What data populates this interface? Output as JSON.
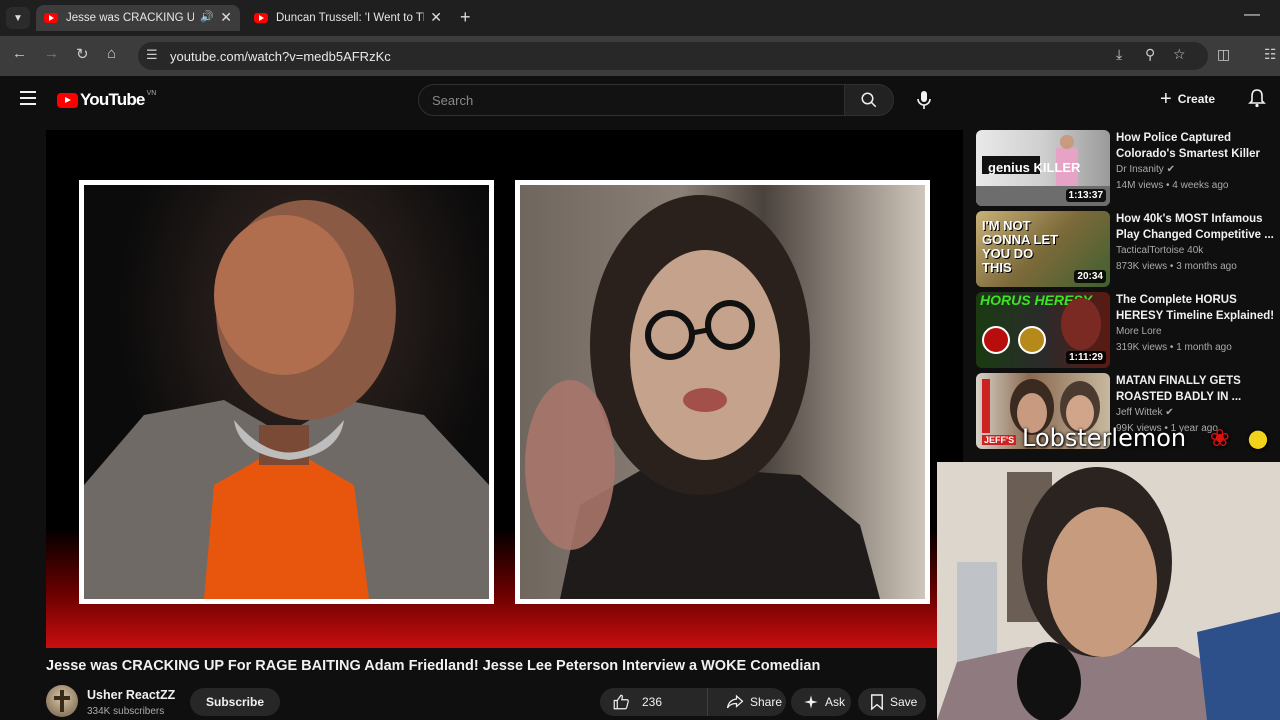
{
  "browser": {
    "tabs": [
      {
        "title": "Jesse was CRACKING UP For",
        "active": true
      },
      {
        "title": "Duncan Trussell: 'I Went to The",
        "active": false
      }
    ],
    "url": "youtube.com/watch?v=medb5AFRzKc"
  },
  "header": {
    "logo_text": "YouTube",
    "country_code": "VN",
    "search_placeholder": "Search",
    "create_label": "Create"
  },
  "video": {
    "title": "Jesse was CRACKING UP For RAGE BAITING Adam Friedland! Jesse Lee Peterson Interview a WOKE Comedian",
    "channel": "Usher ReactZZ",
    "subscribers": "334K subscribers",
    "subscribe_label": "Subscribe",
    "likes": "236",
    "share_label": "Share",
    "ask_label": "Ask",
    "save_label": "Save"
  },
  "recommendations": [
    {
      "title": "How Police Captured Colorado's Smartest Killer",
      "channel": "Dr Insanity",
      "verified": true,
      "meta": "14M views • 4 weeks ago",
      "duration": "1:13:37",
      "thumb_text": "genius KILLER"
    },
    {
      "title": "How 40k's MOST Infamous Play Changed Competitive ...",
      "channel": "TacticalTortoise 40k",
      "verified": false,
      "meta": "873K views • 3 months ago",
      "duration": "20:34",
      "thumb_text": "I'M NOT GONNA LET YOU DO THIS"
    },
    {
      "title": "The Complete HORUS HERESY Timeline Explained!",
      "channel": "More Lore",
      "verified": false,
      "meta": "319K views • 1 month ago",
      "duration": "1:11:29",
      "thumb_text": "HORUS HERESY"
    },
    {
      "title": "MATAN FINALLY GETS ROASTED BADLY IN ...",
      "channel": "Jeff Wittek",
      "verified": true,
      "meta": "99K views • 1 year ago",
      "duration": "",
      "thumb_text": "JEFF'S"
    }
  ],
  "overlay": {
    "streamer_name": "Lobsterlemon"
  }
}
